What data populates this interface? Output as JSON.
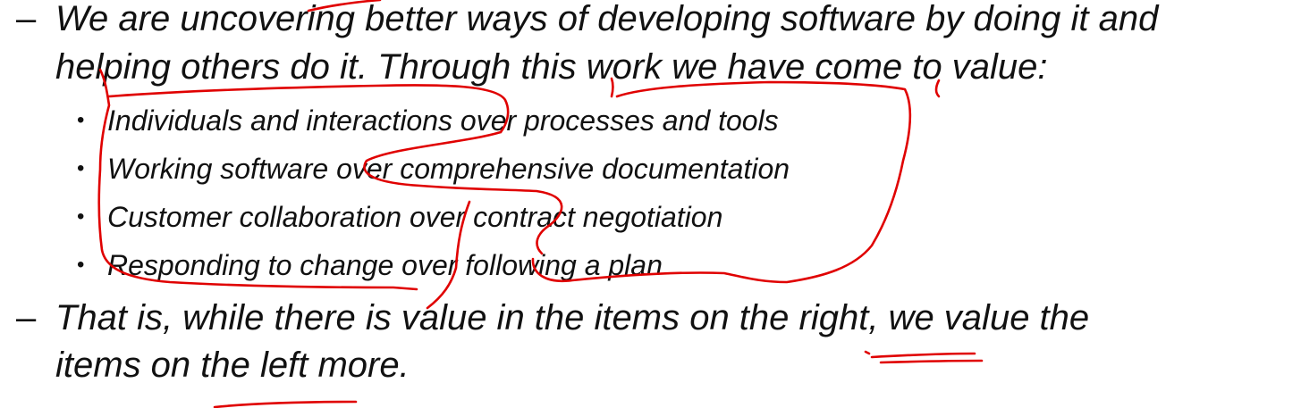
{
  "paragraph1": {
    "dash": "–",
    "line1": "We are uncovering better ways of developing software by doing it and",
    "line2": "helping others do it. Through this work we have come to value:"
  },
  "values": [
    {
      "bullet": "•",
      "text": "Individuals and interactions over processes and tools"
    },
    {
      "bullet": "•",
      "text": "Working software over comprehensive documentation"
    },
    {
      "bullet": "•",
      "text": "Customer collaboration over contract negotiation"
    },
    {
      "bullet": "•",
      "text": "Responding to change over following a plan"
    }
  ],
  "paragraph2": {
    "dash": "–",
    "line1": "That is, while there is value in the items on the right, we value the",
    "line2": "items on the left more."
  },
  "annotation_color": "#e00000"
}
